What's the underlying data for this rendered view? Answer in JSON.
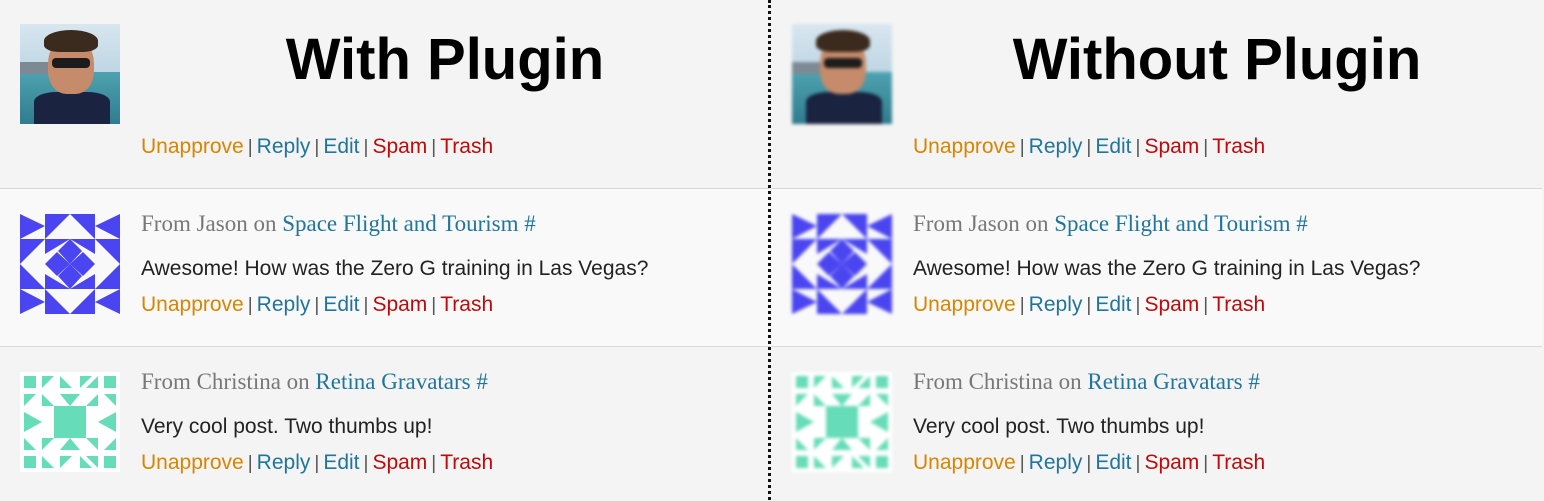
{
  "panels": [
    {
      "heading": "With Plugin",
      "crisp": true,
      "comments": [
        {
          "author_prefix": "",
          "author": "",
          "on_word": "",
          "post_title": "",
          "text": "",
          "actions": [
            "Unapprove",
            "Reply",
            "Edit",
            "Spam",
            "Trash"
          ]
        },
        {
          "author_prefix": "From Jason on ",
          "post_title": "Space Flight and Tourism #",
          "text": "Awesome! How was the Zero G training in Las Vegas?",
          "actions": [
            "Unapprove",
            "Reply",
            "Edit",
            "Spam",
            "Trash"
          ]
        },
        {
          "author_prefix": "From Christina on ",
          "post_title": "Retina Gravatars #",
          "text": "Very cool post. Two thumbs up!",
          "actions": [
            "Unapprove",
            "Reply",
            "Edit",
            "Spam",
            "Trash"
          ]
        }
      ]
    },
    {
      "heading": "Without Plugin",
      "crisp": false,
      "comments": [
        {
          "author_prefix": "",
          "post_title": "",
          "text": "",
          "actions": [
            "Unapprove",
            "Reply",
            "Edit",
            "Spam",
            "Trash"
          ]
        },
        {
          "author_prefix": "From Jason on ",
          "post_title": "Space Flight and Tourism #",
          "text": "Awesome! How was the Zero G training in Las Vegas?",
          "actions": [
            "Unapprove",
            "Reply",
            "Edit",
            "Spam",
            "Trash"
          ]
        },
        {
          "author_prefix": "From Christina on ",
          "post_title": "Retina Gravatars #",
          "text": "Very cool post. Two thumbs up!",
          "actions": [
            "Unapprove",
            "Reply",
            "Edit",
            "Spam",
            "Trash"
          ]
        }
      ]
    }
  ],
  "separator": "|",
  "colors": {
    "unapprove": "#d98500",
    "link": "#21759b",
    "danger": "#bc0b0b",
    "identicon_jason": "#4a45f0",
    "identicon_christina": "#66dcb8"
  },
  "icons": {
    "avatar_1": "user-photo-avatar",
    "avatar_2": "identicon-avatar-jason",
    "avatar_3": "identicon-avatar-christina"
  }
}
